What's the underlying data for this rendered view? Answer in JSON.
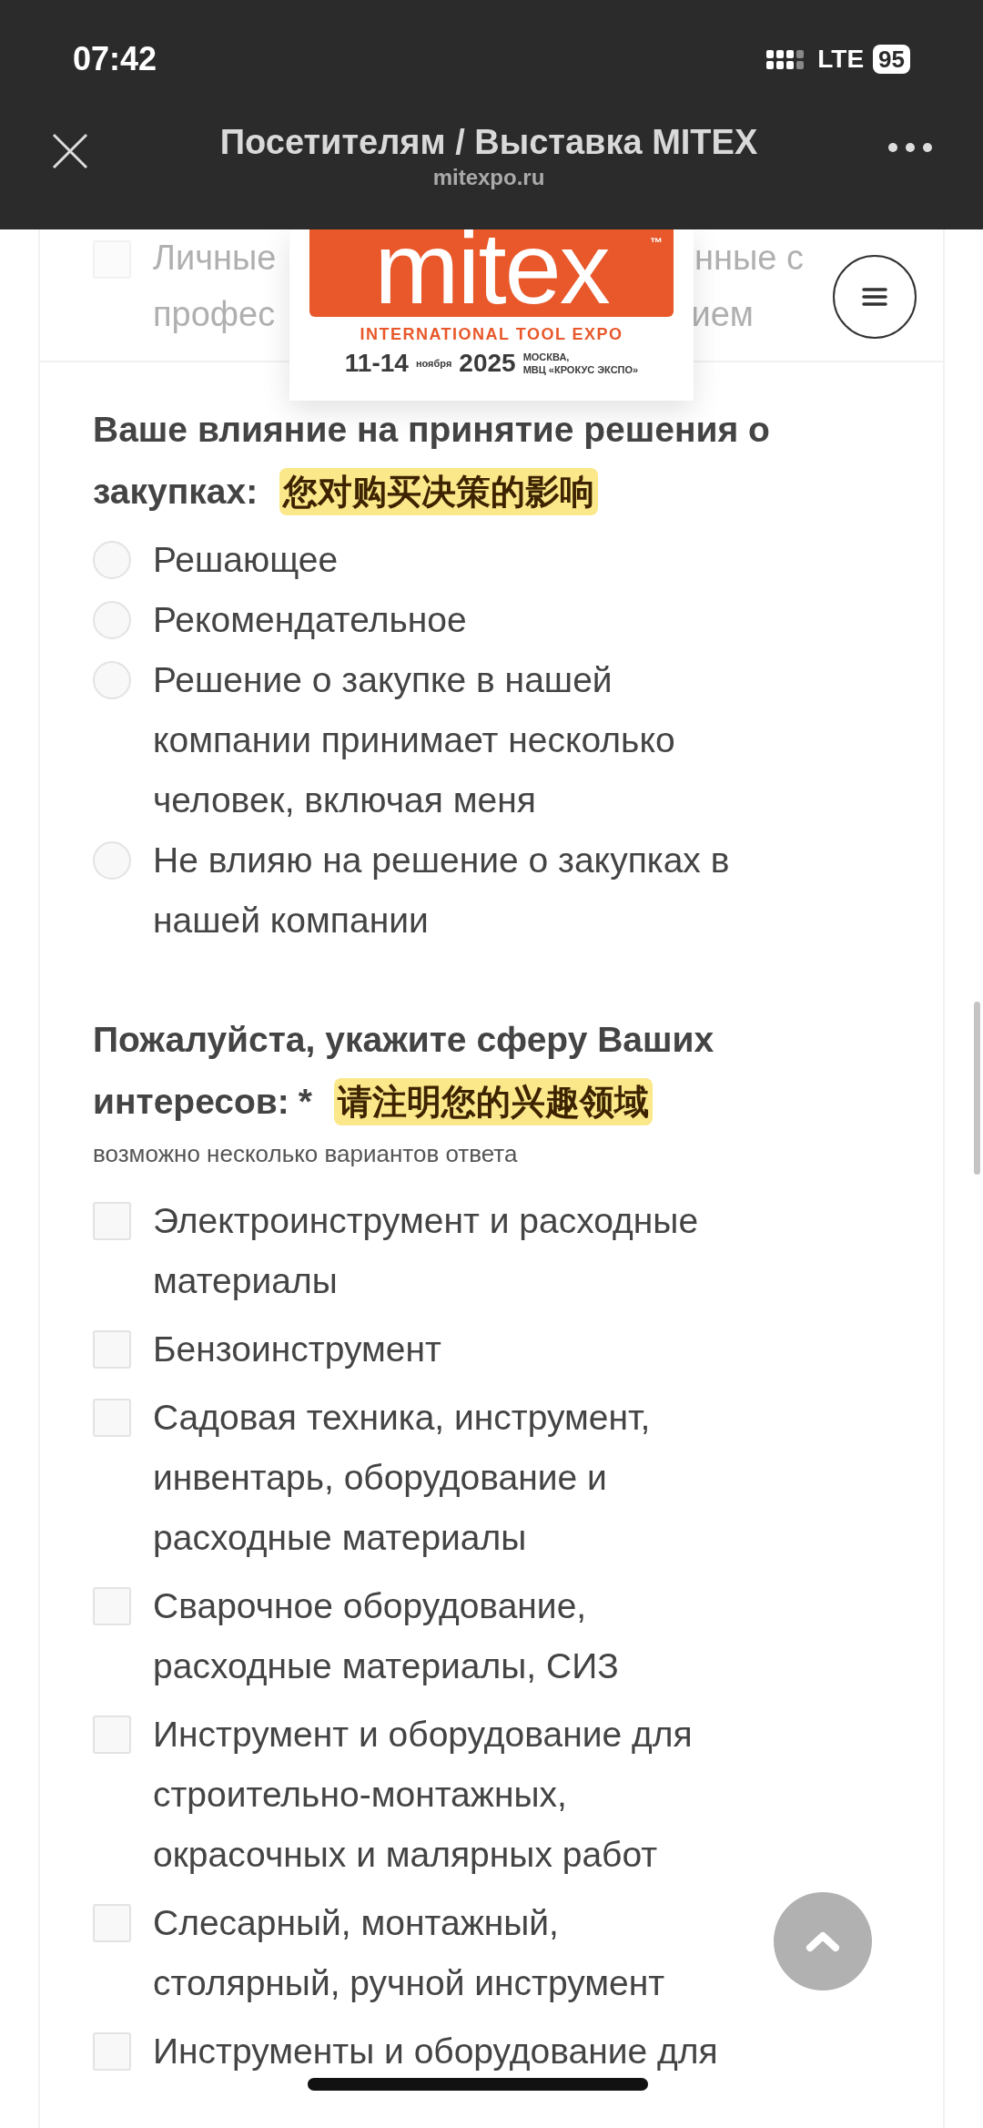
{
  "status_bar": {
    "time": "07:42",
    "network": "LTE",
    "battery": "95"
  },
  "nav_bar": {
    "title": "Посетителям / Выставка MITEX",
    "domain": "mitexpo.ru"
  },
  "logo": {
    "wordmark": "mitex",
    "trademark": "™",
    "tagline": "INTERNATIONAL TOOL EXPO",
    "dates": "11-14",
    "month": "ноября",
    "year": "2025",
    "city": "МОСКВА,",
    "venue": "МВЦ «КРОКУС ЭКСПО»"
  },
  "faded_item": {
    "checked": false,
    "lines": [
      [
        "Личные",
        "нные с"
      ],
      [
        "профес",
        "ием"
      ]
    ]
  },
  "questions": [
    {
      "kind": "radio",
      "title": "Ваше влияние на принятие решения о закупках:",
      "translation": "您对购买决策的影响",
      "options": [
        {
          "label": "Решающее",
          "selected": false
        },
        {
          "label": "Рекомендательное",
          "selected": false
        },
        {
          "label": "Решение о закупке в нашей компании принимает несколько человек, включая меня",
          "selected": false
        },
        {
          "label": "Не влияю на решение о закупках в нашей компании",
          "selected": false
        }
      ]
    },
    {
      "kind": "checkbox",
      "title": "Пожалуйста, укажите сферу Ваших интересов:",
      "required_mark": "*",
      "translation": "请注明您的兴趣领域",
      "hint": "возможно несколько вариантов ответа",
      "options": [
        {
          "label": "Электроинструмент и расходные материалы",
          "checked": false
        },
        {
          "label": "Бензоинструмент",
          "checked": false
        },
        {
          "label": "Садовая техника, инструмент, инвентарь, оборудование и расходные материалы",
          "checked": false
        },
        {
          "label": "Сварочное оборудование, расходные материалы, СИЗ",
          "checked": false
        },
        {
          "label": "Инструмент и оборудование для строительно-монтажных, окрасочных и малярных работ",
          "checked": false
        },
        {
          "label": "Слесарный, монтажный, столярный, ручной инструмент",
          "checked": false
        },
        {
          "label": "Инструменты и оборудование для",
          "checked": false
        }
      ]
    }
  ]
}
